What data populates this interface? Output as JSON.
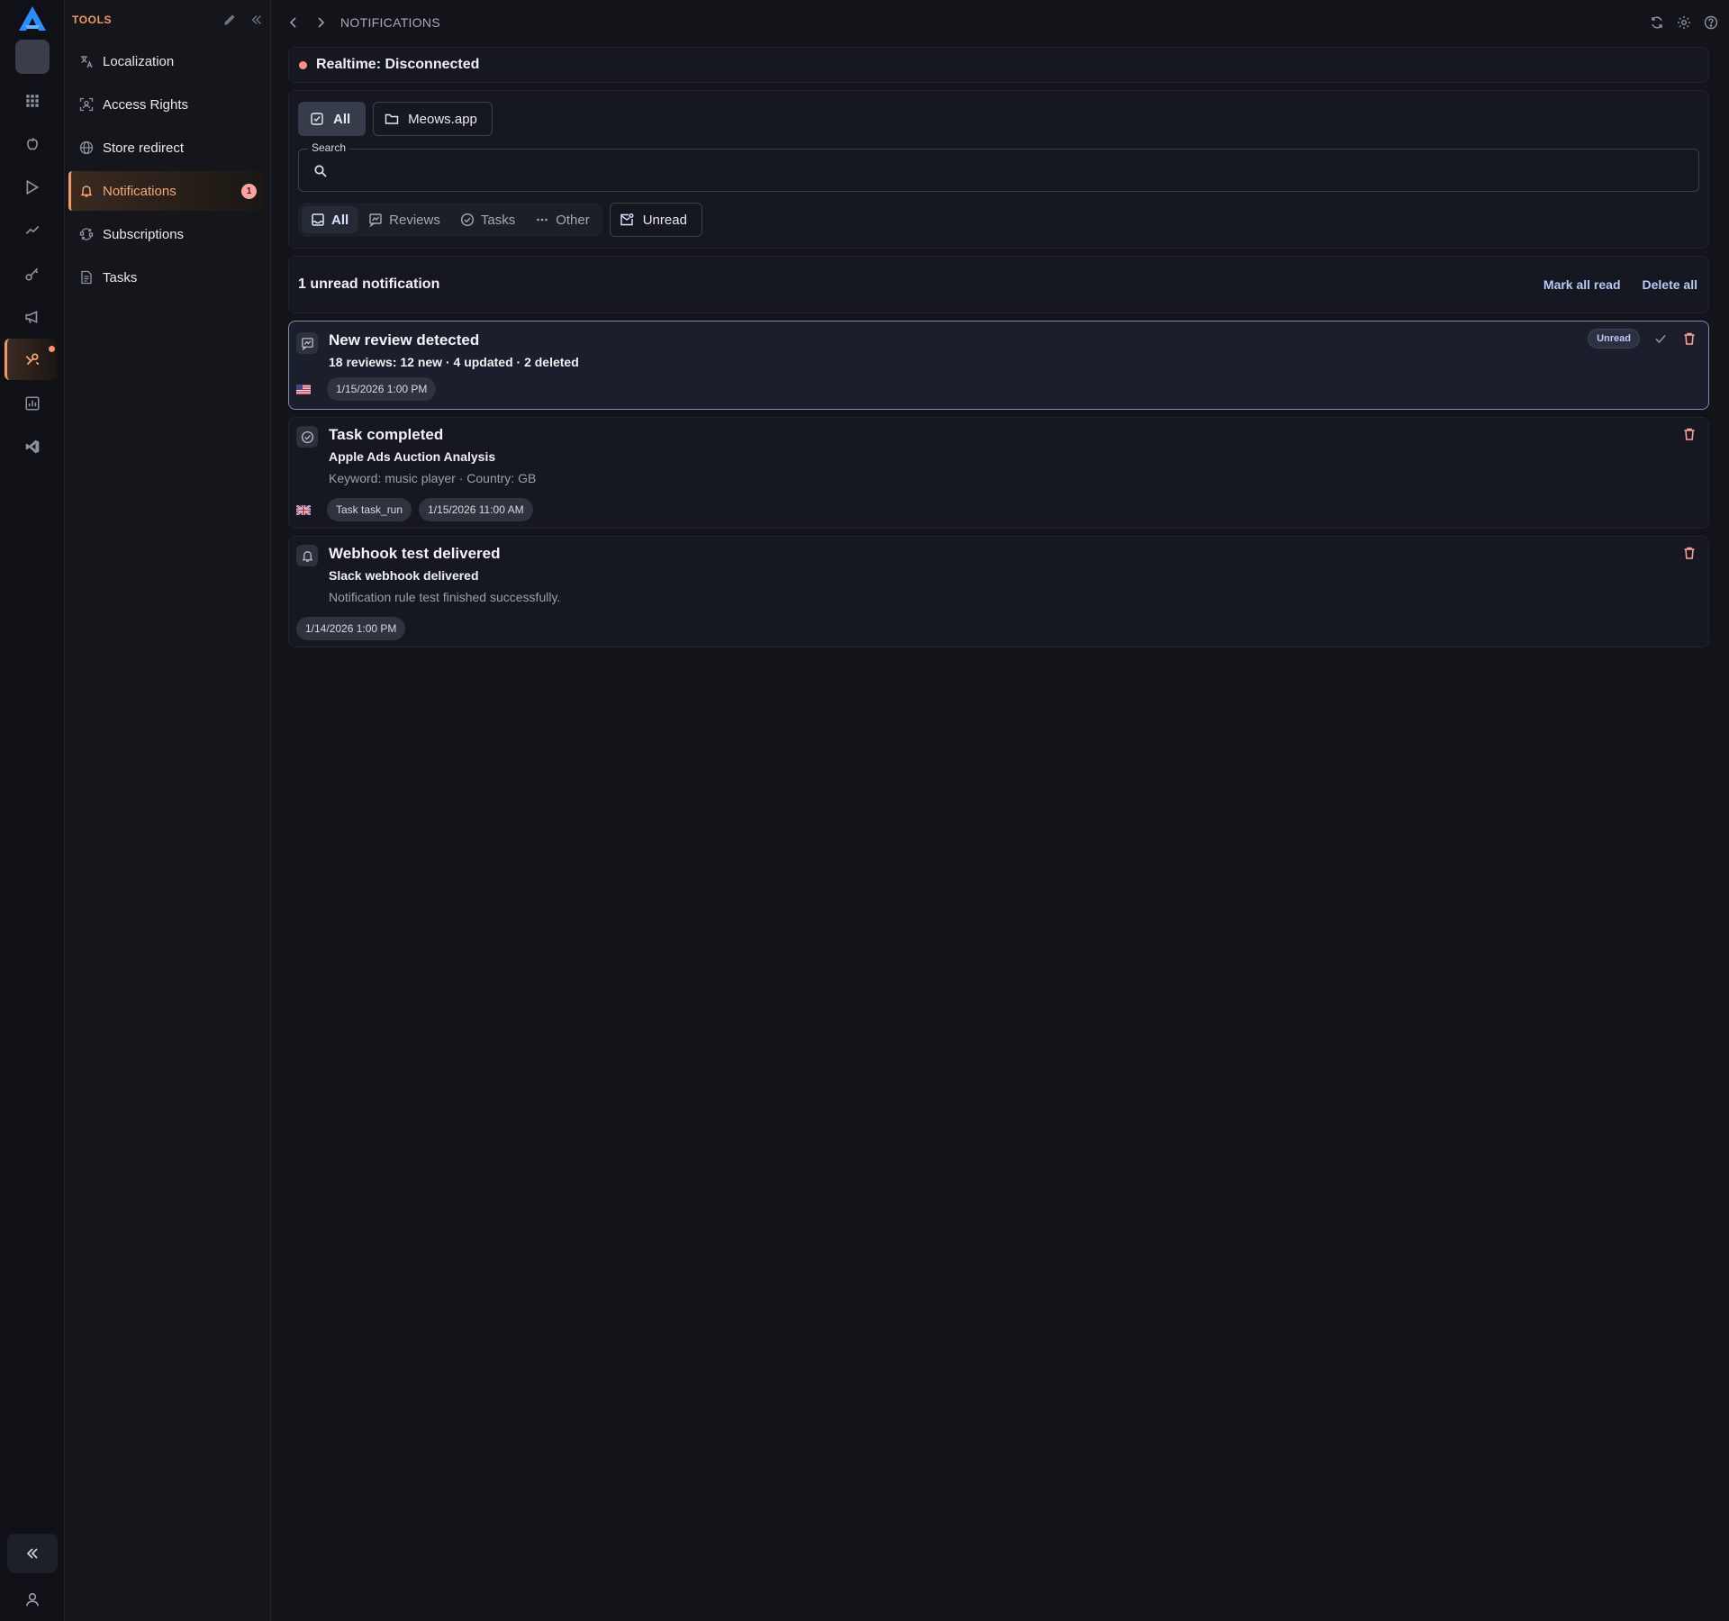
{
  "sidebar": {
    "title": "TOOLS",
    "items": [
      {
        "label": "Localization",
        "icon": "translate-icon"
      },
      {
        "label": "Access Rights",
        "icon": "access-icon"
      },
      {
        "label": "Store redirect",
        "icon": "globe-icon"
      },
      {
        "label": "Notifications",
        "icon": "bell-icon",
        "badge": "1",
        "active": true
      },
      {
        "label": "Subscriptions",
        "icon": "subscriptions-icon"
      },
      {
        "label": "Tasks",
        "icon": "tasks-icon"
      }
    ]
  },
  "header": {
    "breadcrumb": "NOTIFICATIONS"
  },
  "realtime": {
    "status": "Realtime: Disconnected",
    "status_color": "#ff8f85"
  },
  "scope": {
    "all_label": "All",
    "app_label": "Meows.app"
  },
  "search": {
    "label": "Search",
    "value": "",
    "placeholder": ""
  },
  "type_filter": {
    "tabs": [
      "All",
      "Reviews",
      "Tasks",
      "Other"
    ],
    "active": "All",
    "unread_label": "Unread"
  },
  "summary": {
    "text": "1 unread notification",
    "mark_all_read": "Mark all read",
    "delete_all": "Delete all"
  },
  "notifications": [
    {
      "title": "New review detected",
      "subtitle": "18 reviews: 12 new · 4 updated · 2 deleted",
      "description": "",
      "flag": "us-flag-icon",
      "chips": [
        "1/15/2026 1:00 PM"
      ],
      "unread": true,
      "unread_label": "Unread",
      "icon": "review-icon"
    },
    {
      "title": "Task completed",
      "subtitle": "Apple Ads Auction Analysis",
      "description": "Keyword: music player · Country: GB",
      "flag": "gb-flag-icon",
      "chips": [
        "Task task_run",
        "1/15/2026 11:00 AM"
      ],
      "unread": false,
      "icon": "check-circle-icon"
    },
    {
      "title": "Webhook test delivered",
      "subtitle": "Slack webhook delivered",
      "description": "Notification rule test finished successfully.",
      "flag": "",
      "chips": [
        "1/14/2026 1:00 PM"
      ],
      "unread": false,
      "icon": "bell-icon"
    }
  ],
  "colors": {
    "accent": "#f29a63",
    "link": "#b9c8f6",
    "danger": "#ff9c92",
    "background": "#12141a"
  }
}
